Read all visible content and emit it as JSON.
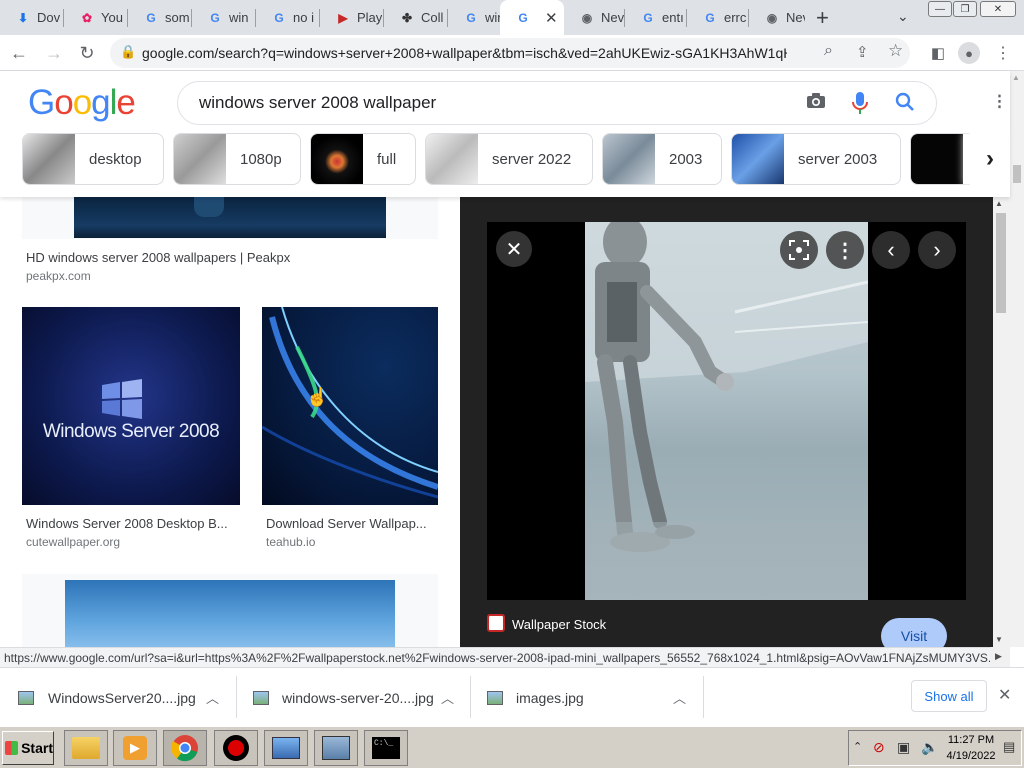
{
  "browser": {
    "tabs": [
      {
        "label": "Dov",
        "icon": "download-icon"
      },
      {
        "label": "You",
        "icon": "flower-icon"
      },
      {
        "label": "som",
        "icon": "google-icon"
      },
      {
        "label": "win",
        "icon": "google-icon"
      },
      {
        "label": "no i",
        "icon": "google-icon"
      },
      {
        "label": "Play",
        "icon": "play-icon"
      },
      {
        "label": "Coll",
        "icon": "puzzle-icon"
      },
      {
        "label": "win",
        "icon": "google-icon"
      },
      {
        "label": "",
        "icon": "google-icon",
        "active": true
      },
      {
        "label": "Nev",
        "icon": "chrome-icon"
      },
      {
        "label": "entı",
        "icon": "google-icon"
      },
      {
        "label": "errc",
        "icon": "google-icon"
      },
      {
        "label": "Nev",
        "icon": "chrome-icon"
      }
    ],
    "new_tab": "+",
    "url": "google.com/search?q=windows+server+2008+wallpaper&tbm=isch&ved=2ahUKEwiz-sGA1KH3AhW1qHIE...",
    "status_url": "https://www.google.com/url?sa=i&url=https%3A%2F%2Fwallpaperstock.net%2Fwindows-server-2008-ipad-mini_wallpapers_56552_768x1024_1.html&psig=AOvVaw1FNAjZsMUMY3VS..."
  },
  "google": {
    "logo": "Google",
    "query": "windows server 2008 wallpaper",
    "chips": [
      "desktop",
      "1080p",
      "full",
      "server 2022",
      "2003",
      "server 2003"
    ]
  },
  "results": [
    {
      "title": "HD windows server 2008 wallpapers | Peakpx",
      "site": "peakpx.com"
    },
    {
      "title": "Windows Server 2008 Desktop B...",
      "site": "cutewallpaper.org",
      "image_text": "Windows Server 2008"
    },
    {
      "title": "Download Server Wallpap...",
      "site": "teahub.io"
    }
  ],
  "viewer": {
    "source": "Wallpaper Stock",
    "visit": "Visit"
  },
  "downloads": {
    "items": [
      "WindowsServer20....jpg",
      "windows-server-20....jpg",
      "images.jpg"
    ],
    "show_all": "Show all"
  },
  "taskbar": {
    "start": "Start",
    "time": "11:27 PM",
    "date": "4/19/2022"
  },
  "colors": {
    "google_blue": "#4285f4",
    "google_red": "#ea4335",
    "google_yellow": "#fbbc05",
    "google_green": "#34a853",
    "visit_button": "#aecbfa"
  }
}
